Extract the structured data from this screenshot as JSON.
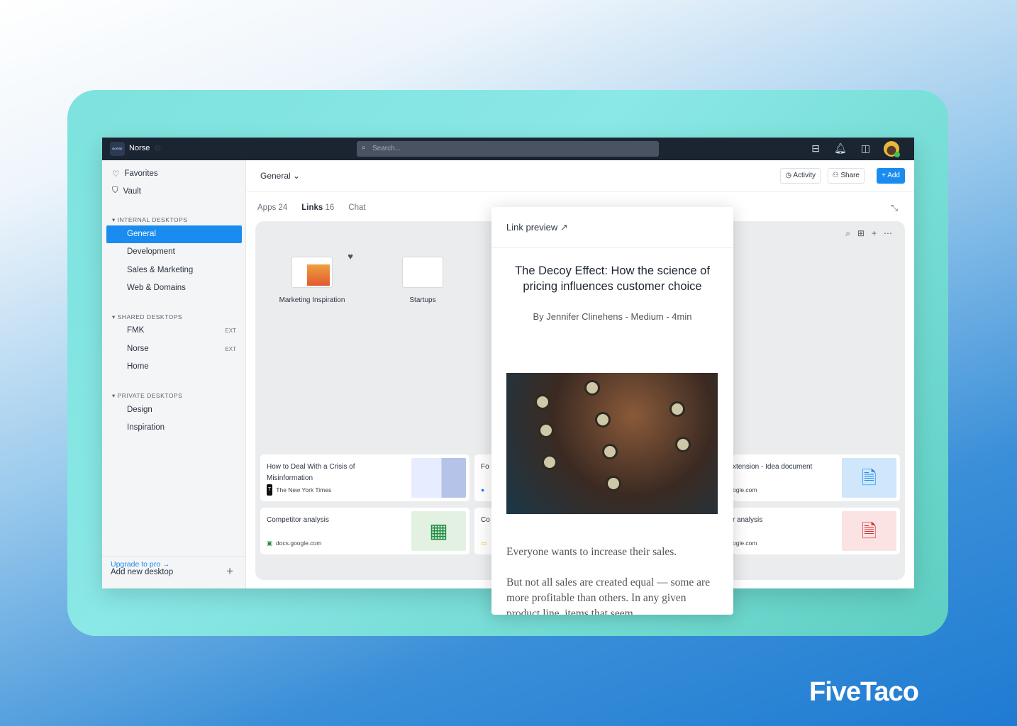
{
  "topbar": {
    "workspace": "Norse",
    "logo_text": "NORSE",
    "search_placeholder": "Search..."
  },
  "sidebar": {
    "favorites": "Favorites",
    "vault": "Vault",
    "internal_header": "INTERNAL DESKTOPS",
    "internal": [
      "General",
      "Development",
      "Sales & Marketing",
      "Web & Domains"
    ],
    "shared_header": "SHARED DESKTOPS",
    "shared": [
      {
        "label": "FMK",
        "badge": "EXT"
      },
      {
        "label": "Norse",
        "badge": "EXT"
      },
      {
        "label": "Home",
        "badge": ""
      }
    ],
    "private_header": "PRIVATE DESKTOPS",
    "private": [
      "Design",
      "Inspiration"
    ],
    "upgrade": "Upgrade to pro →",
    "add_desktop": "Add new desktop"
  },
  "header": {
    "desktop": "General",
    "activity": "Activity",
    "share": "Share",
    "add": "Add"
  },
  "tabs": [
    {
      "label": "Apps",
      "count": "24"
    },
    {
      "label": "Links",
      "count": "16"
    },
    {
      "label": "Chat",
      "count": ""
    }
  ],
  "folders": [
    "Marketing Inspiration",
    "Startups"
  ],
  "cards": [
    {
      "title": "How to Deal With a Crisis of Misinformation",
      "source": "The New York Times"
    },
    {
      "title": "Competitor analysis",
      "source": "docs.google.com"
    },
    {
      "title": "Fo",
      "source": ""
    },
    {
      "title": "Co",
      "source": ""
    },
    {
      "title": "xtension - Idea document",
      "source": "ogle.com"
    },
    {
      "title": "r analysis",
      "source": "ogle.com"
    }
  ],
  "preview": {
    "label": "Link preview",
    "title": "The Decoy Effect: How the science of pricing influences customer choice",
    "byline": "By Jennifer Clinehens - Medium - 4min",
    "para1": "Everyone wants to increase their sales.",
    "para2": "But not all sales are created equal — some are more profitable than others. In any given product line, items that seem"
  },
  "brand": "FiveTaco",
  "colors": {
    "accent": "#1a8cf0",
    "topbar": "#1b2532"
  }
}
